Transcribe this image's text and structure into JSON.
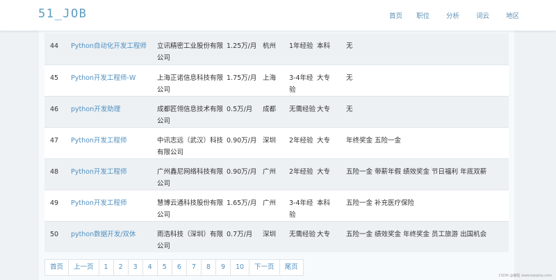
{
  "navbar": {
    "brand": "51_JOB",
    "links": [
      "首页",
      "职位",
      "分析",
      "词云",
      "地区"
    ]
  },
  "table": {
    "rows": [
      {
        "idx": "44",
        "title": "Python自动化开发工程师",
        "company": "立讯精密工业股份有限公司",
        "salary": "1.25万/月",
        "city": "杭州",
        "exp": "1年经验",
        "edu": "本科",
        "benefits": "无"
      },
      {
        "idx": "45",
        "title": "Python开发工程师-W",
        "company": "上海正诺信息科技有限公司",
        "salary": "1.75万/月",
        "city": "上海",
        "exp": "3-4年经验",
        "edu": "大专",
        "benefits": "无"
      },
      {
        "idx": "46",
        "title": "python开发助理",
        "company": "成都匠翎信息技术有限公司",
        "salary": "0.5万/月",
        "city": "成都",
        "exp": "无需经验",
        "edu": "大专",
        "benefits": "无"
      },
      {
        "idx": "47",
        "title": "Python开发工程师",
        "company": "中讯志远（武汉）科技有限公司",
        "salary": "0.90万/月",
        "city": "深圳",
        "exp": "2年经验",
        "edu": "大专",
        "benefits": "年终奖金 五险一金"
      },
      {
        "idx": "48",
        "title": "Python开发工程师",
        "company": "广州鑫尼网络科技有限公司",
        "salary": "0.90万/月",
        "city": "广州",
        "exp": "2年经验",
        "edu": "大专",
        "benefits": "五险一金 带薪年假 绩效奖金 节日福利 年底双薪"
      },
      {
        "idx": "49",
        "title": "Python开发工程师",
        "company": "慧博云通科技股份有限公司",
        "salary": "1.65万/月",
        "city": "广州",
        "exp": "3-4年经验",
        "edu": "本科",
        "benefits": "五险一金 补充医疗保险"
      },
      {
        "idx": "50",
        "title": "python数据开发/双休",
        "company": "雨浩科技（深圳）有限公司",
        "salary": "0.7万/月",
        "city": "深圳",
        "exp": "无需经验",
        "edu": "大专",
        "benefits": "五险一金 绩效奖金 年终奖金 员工旅游 出国机会"
      }
    ]
  },
  "pagination": {
    "first": "首页",
    "prev": "上一页",
    "pages": [
      "1",
      "2",
      "3",
      "4",
      "5",
      "6",
      "7",
      "8",
      "9",
      "10"
    ],
    "next": "下一页",
    "last": "尾页"
  },
  "watermark": "CSDN @编程 www.kaophp.com"
}
